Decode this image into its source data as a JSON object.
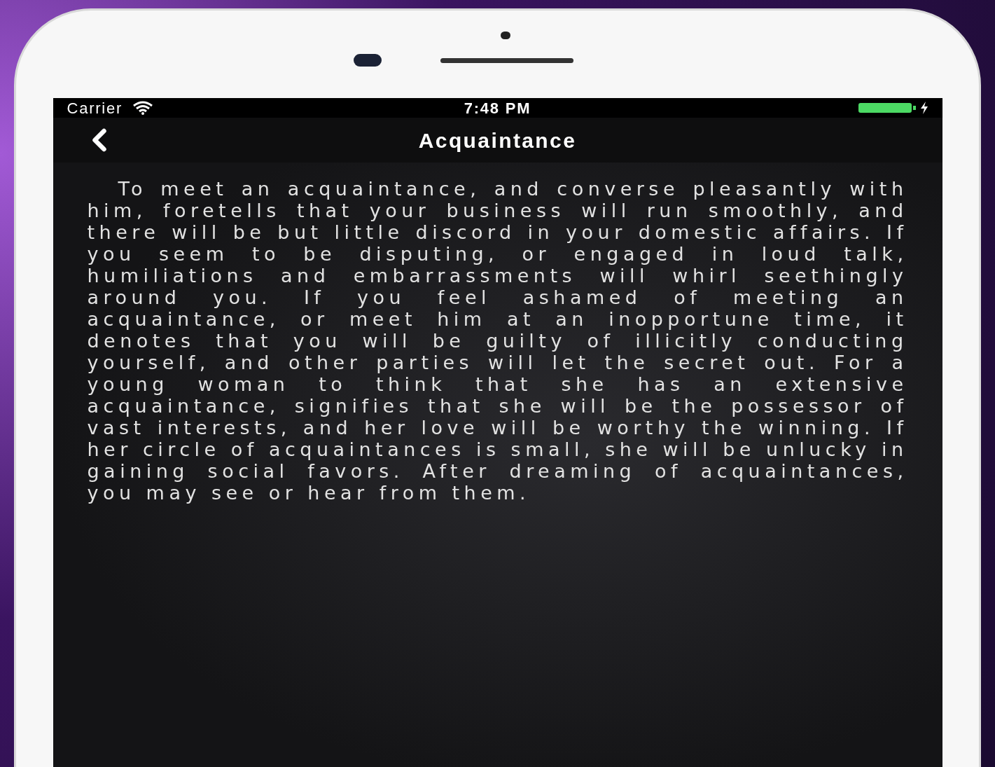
{
  "status_bar": {
    "carrier": "Carrier",
    "time": "7:48 PM"
  },
  "nav_bar": {
    "title": "Acquaintance"
  },
  "body": "To meet an acquaintance, and converse pleasantly with him, foretells that your business will run smoothly, and there will be but little discord in your domestic affairs. If you seem to be disputing, or engaged in loud talk, humiliations and embarrassments will whirl seethingly around you. If you feel ashamed of meeting an acquaintance, or meet him at an inopportune time, it denotes that you will be guilty of illicitly conducting yourself, and other parties will let the secret out. For a young woman to think that she has an extensive acquaintance, signifies that she will be the possessor of vast interests, and her love will be worthy the winning. If her circle of acquaintances is small, she will be unlucky in gaining social favors. After dreaming of acquaintances, you may see or hear from them."
}
